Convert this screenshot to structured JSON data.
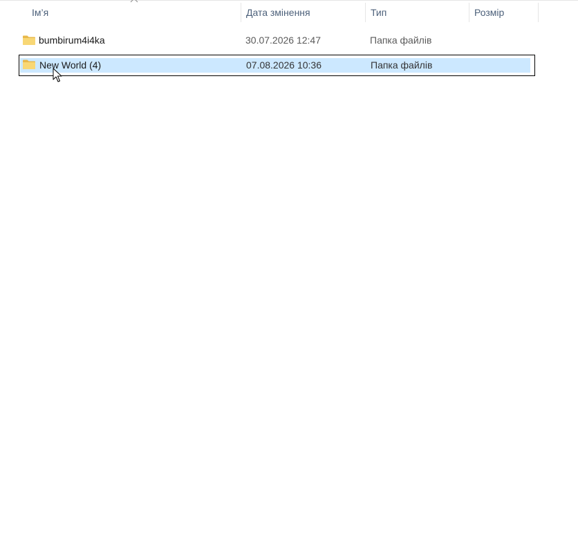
{
  "columns": {
    "name": "Ім’я",
    "date_modified": "Дата змінення",
    "type": "Тип",
    "size": "Розмір"
  },
  "sort": {
    "column": "name",
    "icon": "chevron-up-icon"
  },
  "files": [
    {
      "name": "bumbirum4i4ka",
      "date_modified": "30.07.2026 12:47",
      "type": "Папка файлів",
      "size": "",
      "icon": "folder-icon",
      "selected": false
    },
    {
      "name": "New World (4)",
      "date_modified": "07.08.2026 10:36",
      "type": "Папка файлів",
      "size": "",
      "icon": "folder-icon",
      "selected": true
    }
  ],
  "colors": {
    "selection_fill": "#cce8ff",
    "selection_border": "#000000",
    "header_text": "#4c607a",
    "folder_yellow": "#f8d775"
  }
}
